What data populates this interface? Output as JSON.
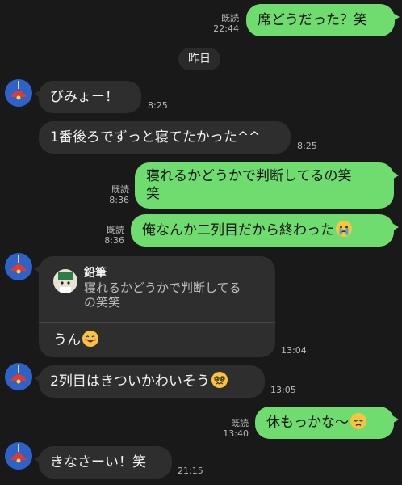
{
  "date_divider": "昨日",
  "messages": [
    {
      "text": "席どうだった？笑",
      "read": "既読",
      "time": "22:44"
    },
    {
      "text": "びみょー！",
      "time": "8:25"
    },
    {
      "text": "1番後ろでずっと寝てたかった^^",
      "time": "8:25"
    },
    {
      "line1": "寝れるかどうかで判断してるの笑",
      "line2": "笑",
      "read": "既読",
      "time": "8:36"
    },
    {
      "text": "俺なんか二列目だから終わった",
      "read": "既読",
      "time": "8:36",
      "emoji": "crying-face"
    },
    {
      "reply_sender": "鉛筆",
      "reply_line1": "寝れるかどうかで判断してる",
      "reply_line2": "の笑笑",
      "text": "うん",
      "time": "13:04",
      "emoji": "smiling-face"
    },
    {
      "text": "2列目はきついかわいそう",
      "time": "13:05",
      "emoji": "dizzy-face"
    },
    {
      "text": "休もっかな〜",
      "read": "既読",
      "time": "13:40",
      "emoji": "disappointed-face"
    },
    {
      "text": "きなさーい！笑",
      "time": "21:15"
    }
  ],
  "icons": {
    "avatar": "red-lamp-avatar",
    "reply_avatar": "pencil-character-avatar"
  },
  "colors": {
    "background": "#191919",
    "outgoing": "#6fdc6f",
    "incoming": "#2e2e2e",
    "avatar_bg": "#2d63c8"
  }
}
